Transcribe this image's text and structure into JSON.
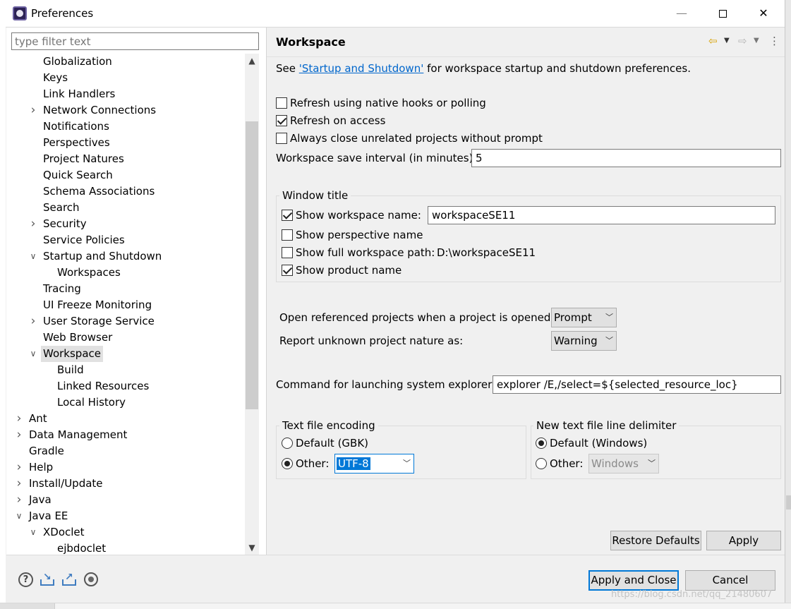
{
  "window": {
    "title": "Preferences",
    "minimize": "—",
    "close": "✕"
  },
  "filter": {
    "placeholder": "type filter text"
  },
  "tree": {
    "items": [
      {
        "label": "Globalization",
        "indent": 1,
        "twisty": ""
      },
      {
        "label": "Keys",
        "indent": 1,
        "twisty": ""
      },
      {
        "label": "Link Handlers",
        "indent": 1,
        "twisty": ""
      },
      {
        "label": "Network Connections",
        "indent": 1,
        "twisty": "collapsed"
      },
      {
        "label": "Notifications",
        "indent": 1,
        "twisty": ""
      },
      {
        "label": "Perspectives",
        "indent": 1,
        "twisty": ""
      },
      {
        "label": "Project Natures",
        "indent": 1,
        "twisty": ""
      },
      {
        "label": "Quick Search",
        "indent": 1,
        "twisty": ""
      },
      {
        "label": "Schema Associations",
        "indent": 1,
        "twisty": ""
      },
      {
        "label": "Search",
        "indent": 1,
        "twisty": ""
      },
      {
        "label": "Security",
        "indent": 1,
        "twisty": "collapsed"
      },
      {
        "label": "Service Policies",
        "indent": 1,
        "twisty": ""
      },
      {
        "label": "Startup and Shutdown",
        "indent": 1,
        "twisty": "expanded"
      },
      {
        "label": "Workspaces",
        "indent": 2,
        "twisty": ""
      },
      {
        "label": "Tracing",
        "indent": 1,
        "twisty": ""
      },
      {
        "label": "UI Freeze Monitoring",
        "indent": 1,
        "twisty": ""
      },
      {
        "label": "User Storage Service",
        "indent": 1,
        "twisty": "collapsed"
      },
      {
        "label": "Web Browser",
        "indent": 1,
        "twisty": ""
      },
      {
        "label": "Workspace",
        "indent": 1,
        "twisty": "expanded",
        "selected": true
      },
      {
        "label": "Build",
        "indent": 2,
        "twisty": ""
      },
      {
        "label": "Linked Resources",
        "indent": 2,
        "twisty": ""
      },
      {
        "label": "Local History",
        "indent": 2,
        "twisty": ""
      },
      {
        "label": "Ant",
        "indent": 0,
        "twisty": "collapsed"
      },
      {
        "label": "Data Management",
        "indent": 0,
        "twisty": "collapsed"
      },
      {
        "label": "Gradle",
        "indent": 0,
        "twisty": ""
      },
      {
        "label": "Help",
        "indent": 0,
        "twisty": "collapsed"
      },
      {
        "label": "Install/Update",
        "indent": 0,
        "twisty": "collapsed"
      },
      {
        "label": "Java",
        "indent": 0,
        "twisty": "collapsed"
      },
      {
        "label": "Java EE",
        "indent": 0,
        "twisty": "expanded"
      },
      {
        "label": "XDoclet",
        "indent": 1,
        "twisty": "expanded"
      },
      {
        "label": "ejbdoclet",
        "indent": 2,
        "twisty": ""
      }
    ]
  },
  "page": {
    "title": "Workspace",
    "intro_prefix": "See",
    "intro_link": "'Startup and Shutdown'",
    "intro_suffix": "for workspace startup and shutdown preferences.",
    "refresh_native": {
      "label": "Refresh using native hooks or polling",
      "checked": false
    },
    "refresh_access": {
      "label": "Refresh on access",
      "checked": true
    },
    "always_close": {
      "label": "Always close unrelated projects without prompt",
      "checked": false
    },
    "save_interval": {
      "label": "Workspace save interval (in minutes):",
      "value": "5"
    },
    "window_title": {
      "group_label": "Window title",
      "show_ws_name": {
        "label": "Show workspace name:",
        "checked": true,
        "value": "workspaceSE11"
      },
      "show_perspective": {
        "label": "Show perspective name",
        "checked": false
      },
      "show_full_path": {
        "label": "Show full workspace path:",
        "checked": false,
        "value": "D:\\workspaceSE11"
      },
      "show_product": {
        "label": "Show product name",
        "checked": true
      }
    },
    "open_referenced": {
      "label": "Open referenced projects when a project is opened:",
      "value": "Prompt"
    },
    "unknown_nature": {
      "label": "Report unknown project nature as:",
      "value": "Warning"
    },
    "explorer_cmd": {
      "label": "Command for launching system explorer:",
      "value": "explorer /E,/select=${selected_resource_loc}"
    },
    "encoding": {
      "group_label": "Text file encoding",
      "default_label": "Default (GBK)",
      "other_label": "Other:",
      "other_value": "UTF-8",
      "selected": "other"
    },
    "delimiter": {
      "group_label": "New text file line delimiter",
      "default_label": "Default (Windows)",
      "other_label": "Other:",
      "other_value": "Windows",
      "selected": "default"
    },
    "restore_defaults": "Restore Defaults",
    "apply": "Apply"
  },
  "footer": {
    "apply_close": "Apply and Close",
    "cancel": "Cancel"
  },
  "watermark": "https://blog.csdn.net/qq_21480607",
  "colors": {
    "accent": "#0078d7",
    "link": "#0066cc",
    "selection": "#e1e1e1"
  }
}
